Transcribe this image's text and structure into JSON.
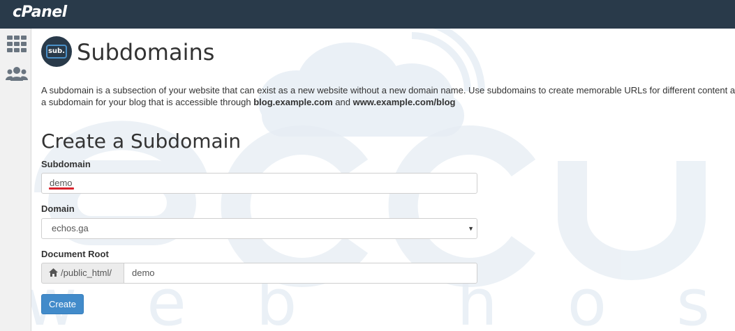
{
  "header": {
    "logo_text": "cPanel"
  },
  "sidebar": {
    "items": [
      {
        "icon": "grid-icon"
      },
      {
        "icon": "users-icon"
      }
    ]
  },
  "page": {
    "icon_text": "sub.",
    "title": "Subdomains",
    "description": {
      "line1": "A subdomain is a subsection of your website that can exist as a new website without a new domain name. Use subdomains to create memorable URLs for different content areas of your site. For example, you can create",
      "line2_prefix": "a subdomain for your blog that is accessible through ",
      "example1": "blog.example.com",
      "and": " and ",
      "example2": "www.example.com/blog"
    }
  },
  "form": {
    "section_title": "Create a Subdomain",
    "subdomain_label": "Subdomain",
    "subdomain_value": "demo",
    "domain_label": "Domain",
    "domain_value": "echos.ga",
    "document_root_label": "Document Root",
    "document_root_prefix": "/public_html/",
    "document_root_value": "demo",
    "create_button": "Create"
  },
  "watermark": {
    "letters": "accu",
    "tagline": "web hosting"
  },
  "colors": {
    "topbar": "#293a4a",
    "button": "#428bca",
    "highlight": "#d9232d"
  }
}
